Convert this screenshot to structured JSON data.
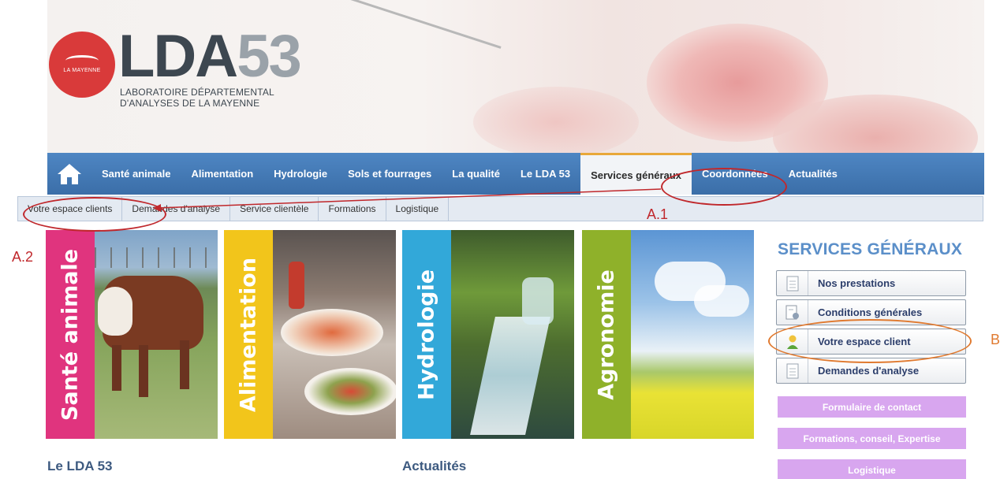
{
  "header": {
    "logo_small_text": "LA MAYENNE",
    "logo_lda": "LDA",
    "logo_num": "53",
    "tagline_line1": "LABORATOIRE DÉPARTEMENTAL",
    "tagline_line2": "D'ANALYSES DE LA MAYENNE"
  },
  "nav": {
    "items": [
      "Santé animale",
      "Alimentation",
      "Hydrologie",
      "Sols et fourrages",
      "La qualité",
      "Le LDA 53",
      "Services généraux",
      "Coordonnées",
      "Actualités"
    ],
    "active_index": 6
  },
  "subnav": {
    "items": [
      "Votre espace clients",
      "Demandes d'analyse",
      "Service clientèle",
      "Formations",
      "Logistique"
    ]
  },
  "tiles": [
    {
      "label": "Santé animale",
      "color": "#e0347e"
    },
    {
      "label": "Alimentation",
      "color": "#f2c51b"
    },
    {
      "label": "Hydrologie",
      "color": "#32a8d9"
    },
    {
      "label": "Agronomie",
      "color": "#8fb12a"
    }
  ],
  "sidebar": {
    "title": "SERVICES GÉNÉRAUX",
    "buttons": [
      "Nos prestations",
      "Conditions générales",
      "Votre espace client",
      "Demandes d'analyse"
    ],
    "purple_buttons": [
      "Formulaire de contact",
      "Formations, conseil, Expertise",
      "Logistique"
    ]
  },
  "sections": {
    "left": "Le LDA 53",
    "middle": "Actualités"
  },
  "annotations": {
    "a1": "A.1",
    "a2": "A.2",
    "b": "B"
  },
  "colors": {
    "nav_blue": "#3f74b0",
    "annotation_red": "#c0282c",
    "annotation_orange": "#e07a30",
    "sidebar_title": "#5b8fc9"
  }
}
